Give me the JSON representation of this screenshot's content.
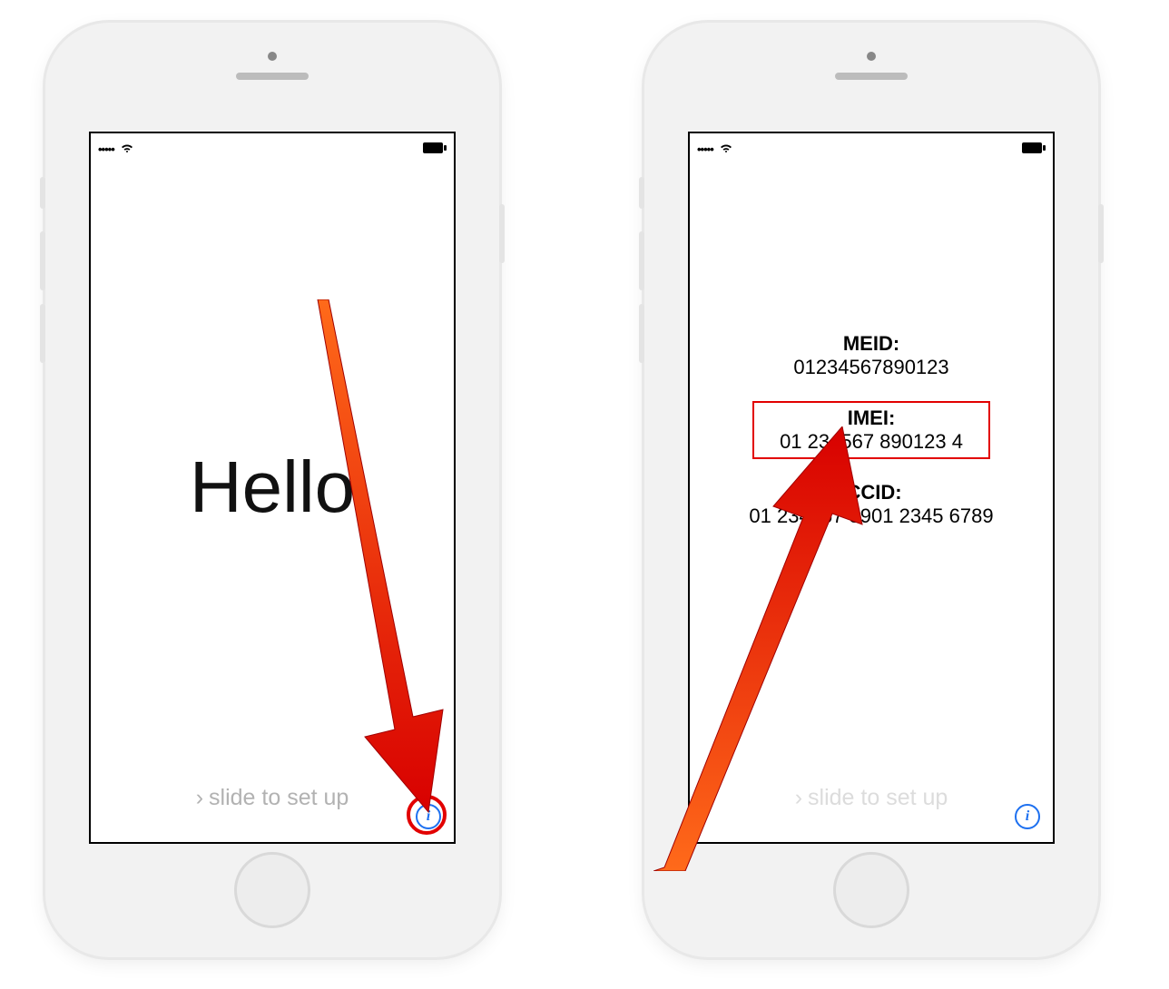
{
  "statusbar": {
    "signal": "•••••",
    "wifi": "wifi-icon",
    "battery": "battery-icon"
  },
  "left_screen": {
    "greeting": "Hello",
    "slide_prompt": "slide to set up",
    "info_icon": "i"
  },
  "right_screen": {
    "slide_prompt": "slide to set up",
    "info_icon": "i",
    "entries": {
      "meid": {
        "label": "MEID:",
        "value": "01234567890123"
      },
      "imei": {
        "label": "IMEI:",
        "value": "01 234567 890123 4"
      },
      "iccid": {
        "label": "ICCID:",
        "value": "01 234567 8901 2345 6789"
      }
    }
  },
  "annotation": {
    "info_highlight_color": "#e20000",
    "arrow_color": "#e42600"
  }
}
